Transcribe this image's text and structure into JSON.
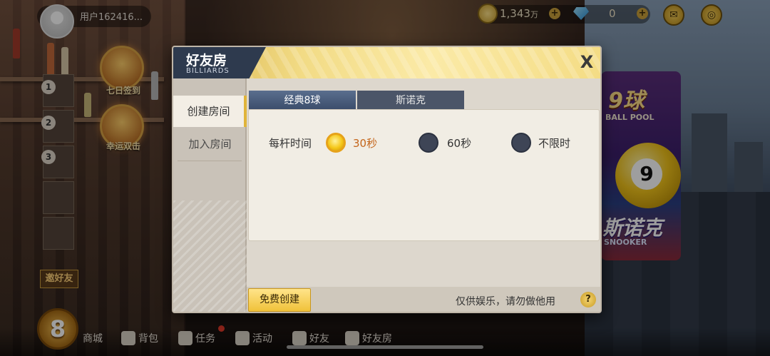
{
  "top_bar": {
    "username": "用户162416...",
    "coins": "1,343",
    "coins_unit": "万",
    "diamonds": "0",
    "plus": "+"
  },
  "side_menu": {
    "daily_signin": "七日签到",
    "lucky_double": "幸运双击",
    "invite_friends": "邀好友",
    "rank_numbers": [
      "1",
      "2",
      "3"
    ]
  },
  "banner": {
    "title_top": "9球",
    "subtitle_top": "BALL POOL",
    "title_bottom": "斯诺克",
    "subtitle_bottom": "SNOOKER"
  },
  "bottom_nav": {
    "level": "8",
    "items": [
      "商城",
      "背包",
      "任务",
      "活动",
      "好友",
      "好友房"
    ]
  },
  "dialog": {
    "title": "好友房",
    "subtitle": "BILLIARDS",
    "close": "X",
    "sidebar": [
      "创建房间",
      "加入房间"
    ],
    "game_tabs": [
      "经典8球",
      "斯诺克"
    ],
    "time_label": "每杆时间",
    "time_options": [
      "30秒",
      "60秒",
      "不限时"
    ],
    "selected_option": "30秒",
    "create_button": "免费创建",
    "disclaimer": "仅供娱乐，请勿做他用",
    "help": "?"
  },
  "colors": {
    "accent_gold": "#f0c23a",
    "selected_text": "#c4651a",
    "tab_active": "#3c4e6c"
  }
}
